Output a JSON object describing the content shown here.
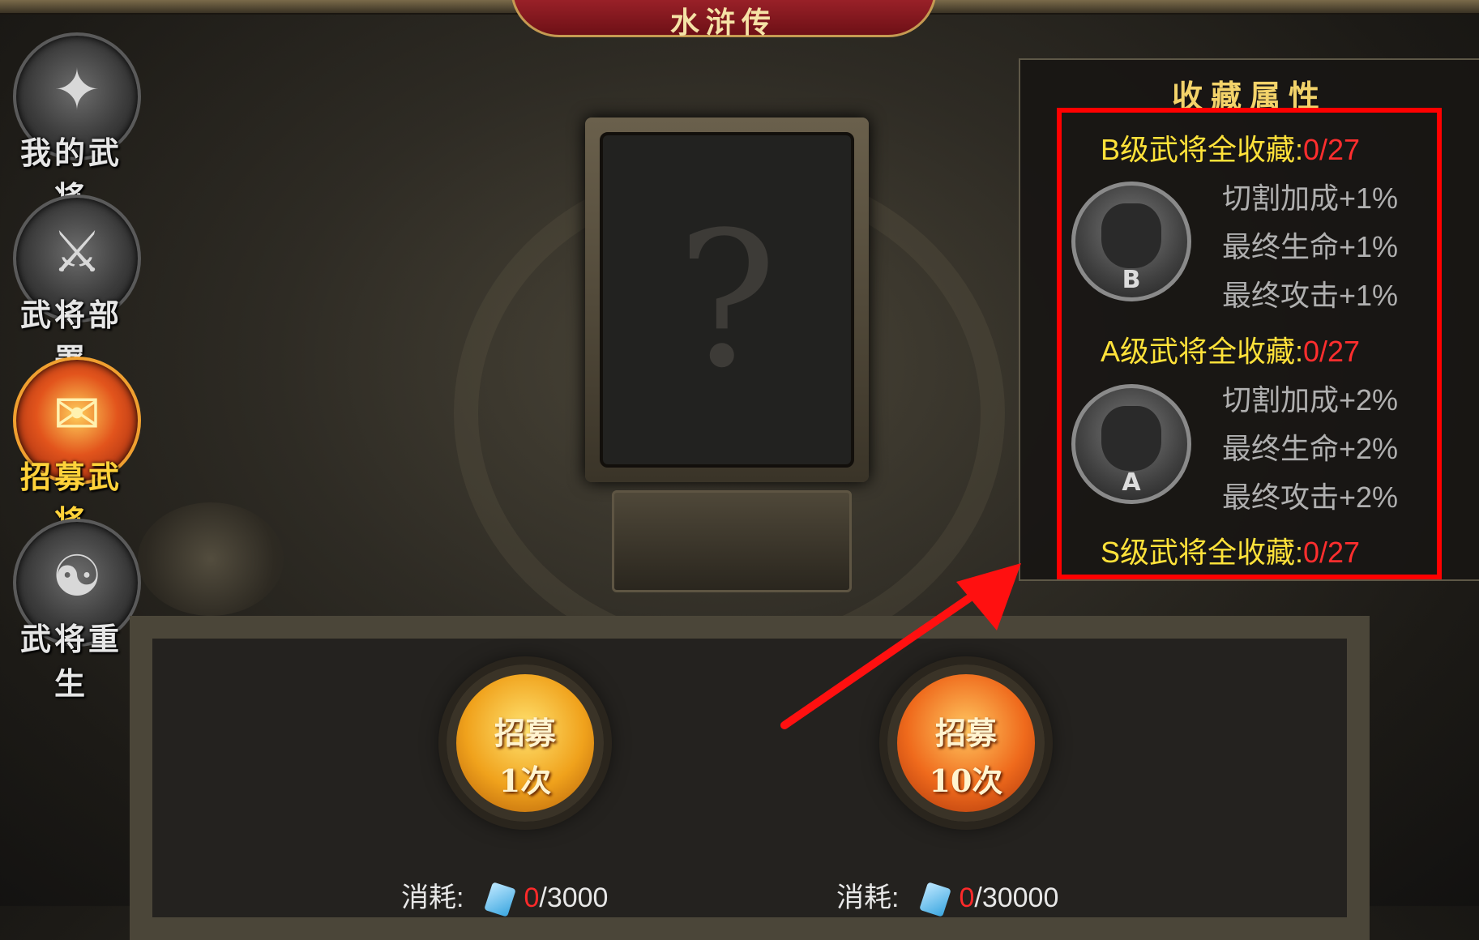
{
  "banner": {
    "title": "水浒传"
  },
  "nav": [
    {
      "label": "我的武将",
      "glyph": "✦",
      "icon": "helmet-icon"
    },
    {
      "label": "武将部署",
      "glyph": "⚔",
      "icon": "crossed-swords-icon"
    },
    {
      "label": "招募武将",
      "glyph": "✉",
      "icon": "recruit-scroll-icon"
    },
    {
      "label": "武将重生",
      "glyph": "☯",
      "icon": "rebirth-spirit-icon"
    }
  ],
  "active_nav": "招募武将",
  "card": {
    "placeholder": "?"
  },
  "recruit": {
    "one": {
      "line1": "招募",
      "line2": "1次"
    },
    "ten": {
      "line1": "招募",
      "line2": "10次"
    }
  },
  "costs": {
    "one": {
      "label": "消耗:",
      "have": "0",
      "need": "/3000"
    },
    "ten": {
      "label": "消耗:",
      "have": "0",
      "need": "/30000"
    }
  },
  "collection": {
    "title": "收藏属性",
    "tiers": [
      {
        "label": "B级武将全收藏:",
        "progress": "0/27",
        "grade": "B",
        "bonuses": [
          "切割加成+1%",
          "最终生命+1%",
          "最终攻击+1%"
        ]
      },
      {
        "label": "A级武将全收藏:",
        "progress": "0/27",
        "grade": "A",
        "bonuses": [
          "切割加成+2%",
          "最终生命+2%",
          "最终攻击+2%"
        ]
      },
      {
        "label": "S级武将全收藏:",
        "progress": "0/27"
      }
    ]
  },
  "colors": {
    "highlight": "#ff0000",
    "tier_label": "#ffe23a",
    "progress": "#ff2e2e",
    "bonus": "#b0b0b0"
  }
}
